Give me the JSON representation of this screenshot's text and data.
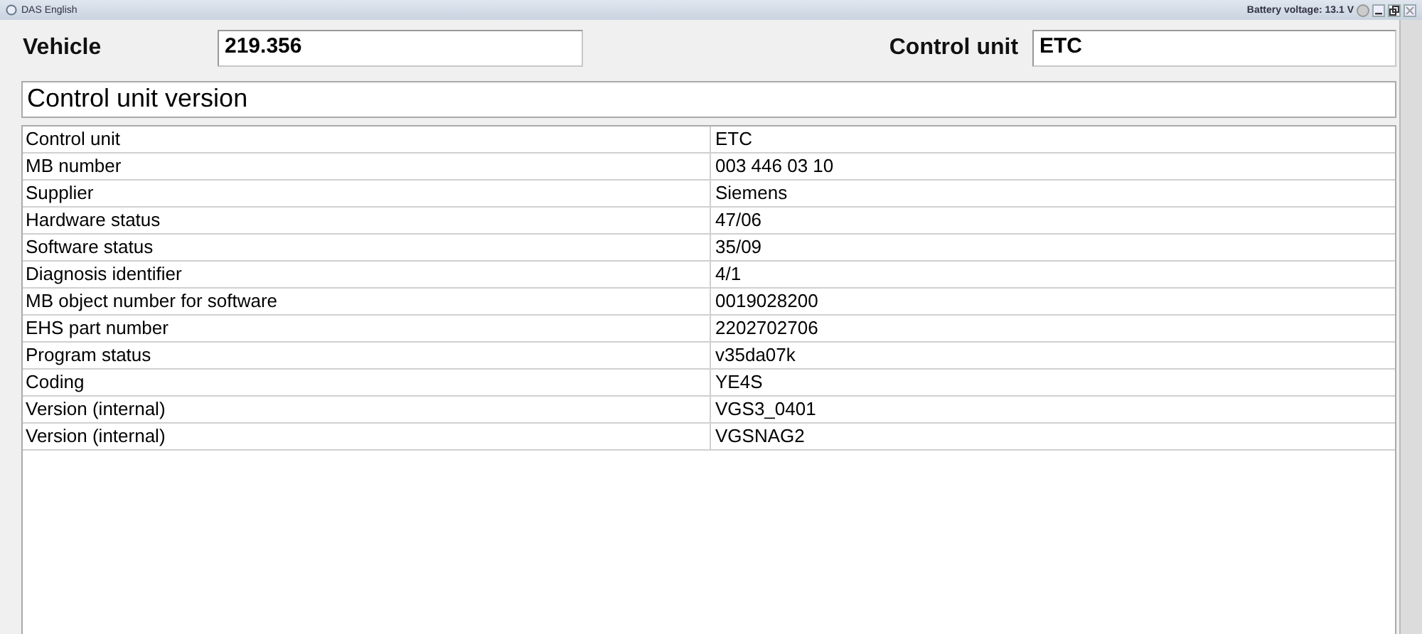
{
  "window": {
    "title": "DAS English",
    "battery": "Battery voltage: 13.1 V"
  },
  "header": {
    "vehicle_label": "Vehicle",
    "vehicle_value": "219.356",
    "control_unit_label": "Control unit",
    "control_unit_value": "ETC"
  },
  "section_title": "Control unit version",
  "table": {
    "rows": [
      {
        "label": "Control unit",
        "value": "ETC"
      },
      {
        "label": "MB number",
        "value": "003 446 03 10"
      },
      {
        "label": "Supplier",
        "value": "Siemens"
      },
      {
        "label": "Hardware status",
        "value": "47/06"
      },
      {
        "label": "Software status",
        "value": "35/09"
      },
      {
        "label": "Diagnosis identifier",
        "value": "4/1"
      },
      {
        "label": "MB object number for software",
        "value": "0019028200"
      },
      {
        "label": "EHS part number",
        "value": "2202702706"
      },
      {
        "label": "Program status",
        "value": "v35da07k"
      },
      {
        "label": "Coding",
        "value": "YE4S"
      },
      {
        "label": "Version (internal)",
        "value": "VGS3_0401"
      },
      {
        "label": "Version (internal)",
        "value": "VGSNAG2"
      }
    ]
  }
}
